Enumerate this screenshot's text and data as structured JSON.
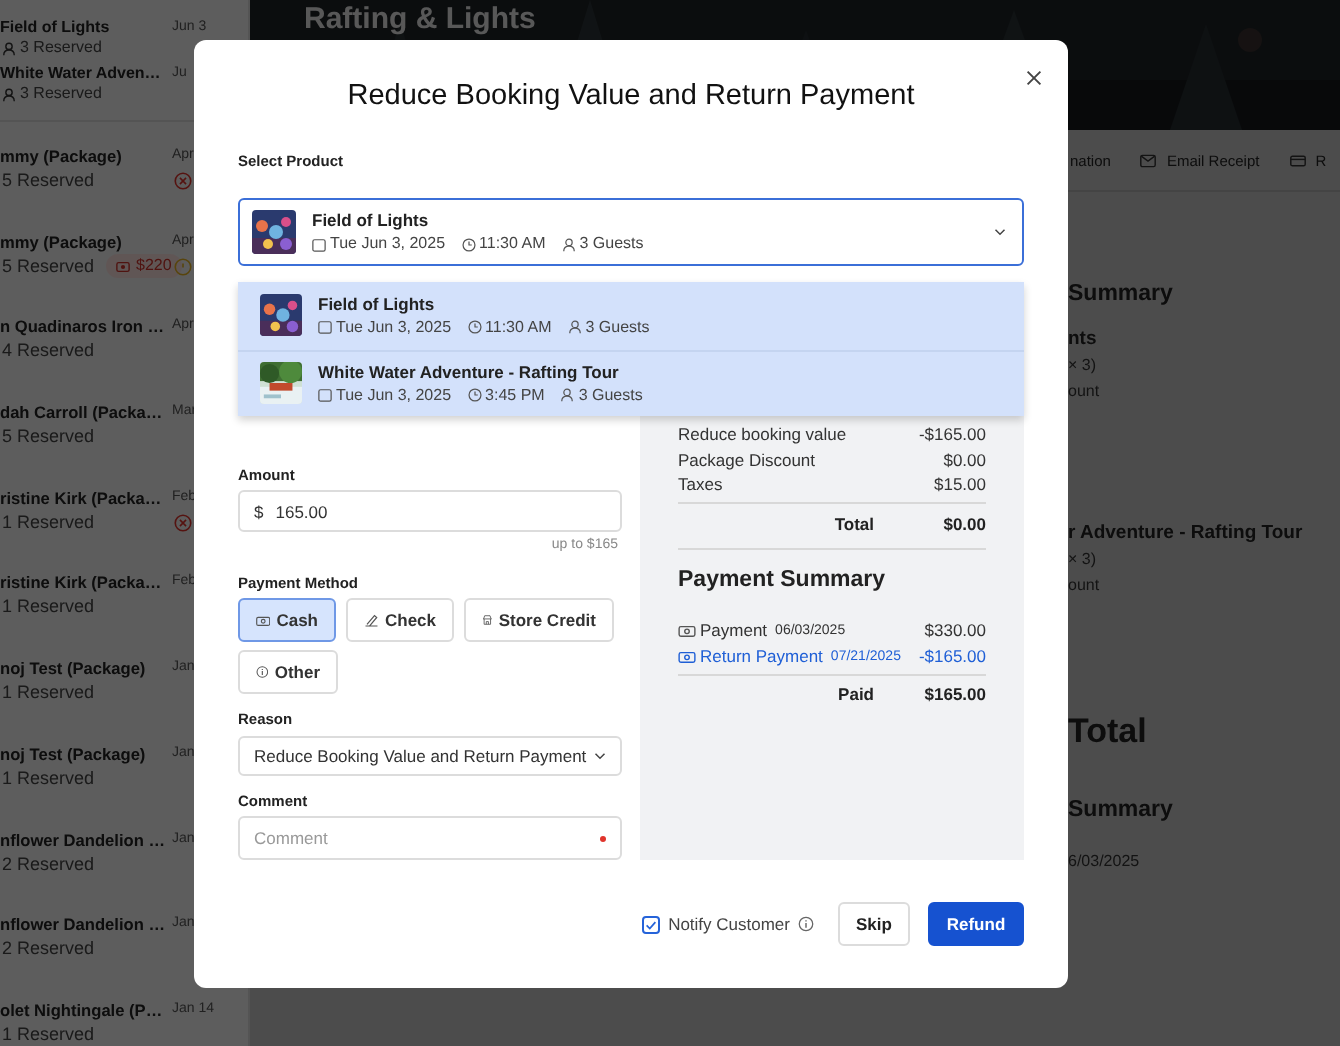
{
  "background": {
    "header_title": "Rafting & Lights",
    "sidebar_items": [
      {
        "kind": "child",
        "name": "Field of Lights",
        "sub": "3 Reserved",
        "date": "Jun 3"
      },
      {
        "kind": "child",
        "name": "White Water Adven…",
        "sub": "3 Reserved",
        "date": "Ju"
      },
      {
        "kind": "booking",
        "name": "mmy (Package)",
        "sub": "5 Reserved",
        "date": "Apr",
        "cancelled": true,
        "pending": false
      },
      {
        "kind": "booking",
        "name": "mmy (Package)",
        "sub": "5 Reserved",
        "date": "Apr",
        "badge": "$220",
        "cancelled": false,
        "pending": true
      },
      {
        "kind": "booking",
        "name": "n Quadinaros Iron …",
        "sub": "4 Reserved",
        "date": "Apr",
        "cancelled": false,
        "pending": false
      },
      {
        "kind": "booking",
        "name": "dah Carroll (Packa…",
        "sub": "5 Reserved",
        "date": "Mar",
        "cancelled": false,
        "pending": false
      },
      {
        "kind": "booking",
        "name": "ristine Kirk (Packa…",
        "sub": "1 Reserved",
        "date": "Feb",
        "cancelled": true,
        "pending": false
      },
      {
        "kind": "booking",
        "name": "ristine Kirk (Packa…",
        "sub": "1 Reserved",
        "date": "Feb",
        "cancelled": false,
        "pending": false
      },
      {
        "kind": "booking",
        "name": "noj Test (Package)",
        "sub": "1 Reserved",
        "date": "Jan",
        "cancelled": false,
        "pending": false
      },
      {
        "kind": "booking",
        "name": "noj Test (Package)",
        "sub": "1 Reserved",
        "date": "Jan",
        "cancelled": false,
        "pending": false
      },
      {
        "kind": "booking",
        "name": "nflower Dandelion …",
        "sub": "2 Reserved",
        "date": "Jan",
        "cancelled": false,
        "pending": false
      },
      {
        "kind": "booking",
        "name": "nflower Dandelion …",
        "sub": "2 Reserved",
        "date": "Jan",
        "cancelled": false,
        "pending": false
      },
      {
        "kind": "booking",
        "name": "olet Nightingale (P…",
        "sub": "1 Reserved",
        "date": "Jan 14",
        "cancelled": false,
        "pending": false
      }
    ],
    "tabs": [
      {
        "label": "nation"
      },
      {
        "label": "Email Receipt"
      },
      {
        "label": "R"
      }
    ],
    "content_lines": [
      {
        "kind": "section",
        "text": "Summary"
      },
      {
        "kind": "item",
        "text": "nts"
      },
      {
        "kind": "detail",
        "text": "× 3)"
      },
      {
        "kind": "detail",
        "text": "ount"
      },
      {
        "kind": "item",
        "text": "r Adventure - Rafting Tour"
      },
      {
        "kind": "detail",
        "text": "× 3)"
      },
      {
        "kind": "detail",
        "text": "ount"
      },
      {
        "kind": "grand",
        "text": "Total"
      },
      {
        "kind": "section",
        "text": "Summary"
      },
      {
        "kind": "detail",
        "text": "6/03/2025"
      }
    ]
  },
  "modal": {
    "title": "Reduce Booking Value and Return Payment",
    "product_label": "Select Product",
    "selected_product": {
      "name": "Field of Lights",
      "date": "Tue Jun 3, 2025",
      "time": "11:30 AM",
      "guests": "3 Guests"
    },
    "product_options": [
      {
        "name": "Field of Lights",
        "date": "Tue Jun 3, 2025",
        "time": "11:30 AM",
        "guests": "3 Guests"
      },
      {
        "name": "White Water Adventure - Rafting Tour",
        "date": "Tue Jun 3, 2025",
        "time": "3:45 PM",
        "guests": "3 Guests"
      }
    ],
    "amount": {
      "label": "Amount",
      "currency": "$",
      "value": "165.00",
      "hint": "up to $165"
    },
    "payment_method": {
      "label": "Payment Method",
      "options": [
        {
          "label": "Cash",
          "selected": true
        },
        {
          "label": "Check",
          "selected": false
        },
        {
          "label": "Store Credit",
          "selected": false
        },
        {
          "label": "Other",
          "selected": false
        }
      ]
    },
    "reason": {
      "label": "Reason",
      "value": "Reduce Booking Value and Return Payment"
    },
    "comment": {
      "label": "Comment",
      "placeholder": "Comment",
      "required": true
    },
    "summary_rows": [
      {
        "label": "Reduce booking value",
        "value": "-$165.00"
      },
      {
        "label": "Package Discount",
        "value": "$0.00"
      },
      {
        "label": "Taxes",
        "value": "$15.00"
      }
    ],
    "total": {
      "label": "Total",
      "value": "$0.00"
    },
    "payment_summary": {
      "title": "Payment Summary",
      "entries": [
        {
          "kind": "payment",
          "label": "Payment",
          "date": "06/03/2025",
          "amount": "$330.00"
        },
        {
          "kind": "refund",
          "label": "Return Payment",
          "date": "07/21/2025",
          "amount": "-$165.00"
        }
      ],
      "paid": {
        "label": "Paid",
        "value": "$165.00"
      }
    },
    "notify": {
      "label": "Notify Customer",
      "checked": true
    },
    "buttons": [
      {
        "kind": "secondary",
        "label": "Skip"
      },
      {
        "kind": "primary",
        "label": "Refund"
      }
    ]
  }
}
